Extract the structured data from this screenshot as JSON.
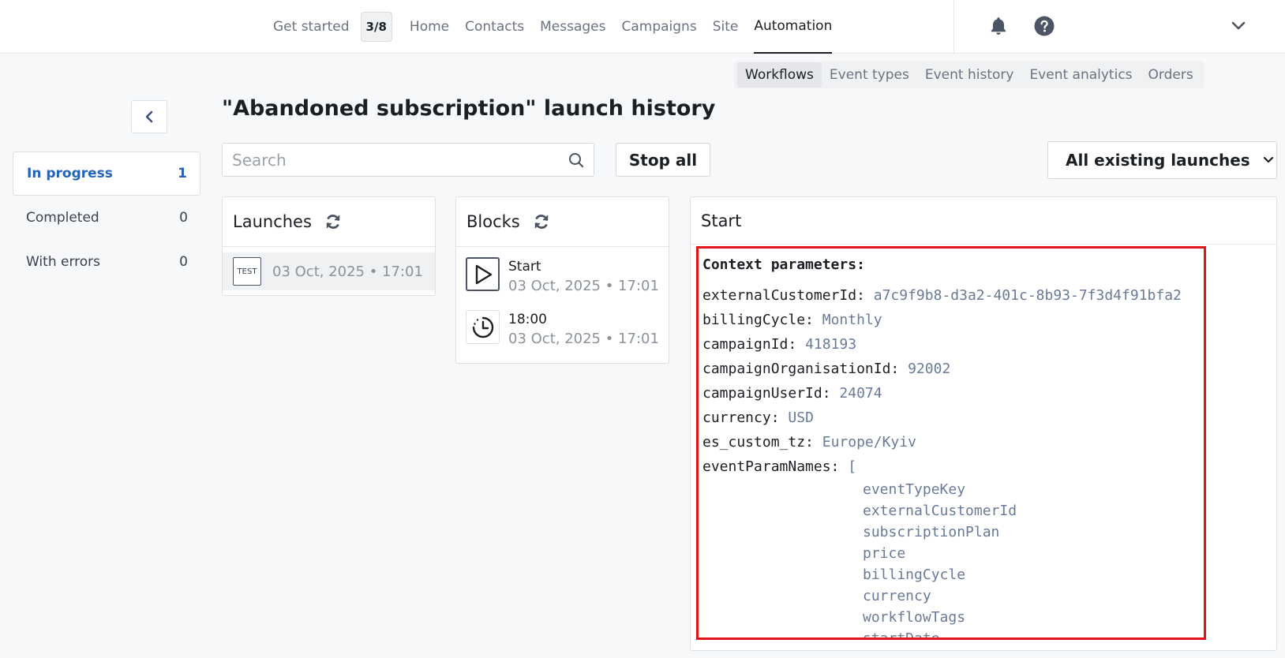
{
  "nav": {
    "get_started": "Get started",
    "progress": "3/8",
    "home": "Home",
    "contacts": "Contacts",
    "messages": "Messages",
    "campaigns": "Campaigns",
    "site": "Site",
    "automation": "Automation"
  },
  "subtabs": {
    "workflows": "Workflows",
    "event_types": "Event types",
    "event_history": "Event history",
    "event_analytics": "Event analytics",
    "orders": "Orders"
  },
  "page_title": "\"Abandoned subscription\" launch history",
  "search": {
    "placeholder": "Search"
  },
  "stop_all": "Stop all",
  "filter": {
    "selected": "All existing launches"
  },
  "statuses": [
    {
      "label": "In progress",
      "count": "1"
    },
    {
      "label": "Completed",
      "count": "0"
    },
    {
      "label": "With errors",
      "count": "0"
    }
  ],
  "launches_panel": {
    "title": "Launches",
    "items": [
      {
        "badge": "TEST",
        "time": "03 Oct, 2025 • 17:01"
      }
    ]
  },
  "blocks_panel": {
    "title": "Blocks",
    "items": [
      {
        "name": "Start",
        "time": "03 Oct, 2025 • 17:01",
        "icon": "play-icon"
      },
      {
        "name": "18:00",
        "time": "03 Oct, 2025 • 17:01",
        "icon": "clock-icon"
      }
    ]
  },
  "detail": {
    "title": "Start",
    "context_title": "Context parameters:",
    "params": [
      {
        "key": "externalCustomerId:",
        "value": "a7c9f9b8-d3a2-401c-8b93-7f3d4f91bfa2"
      },
      {
        "key": "billingCycle:",
        "value": "Monthly"
      },
      {
        "key": "campaignId:",
        "value": "418193"
      },
      {
        "key": "campaignOrganisationId:",
        "value": "92002"
      },
      {
        "key": "campaignUserId:",
        "value": "24074"
      },
      {
        "key": "currency:",
        "value": "USD"
      },
      {
        "key": "es_custom_tz:",
        "value": "Europe/Kyiv"
      },
      {
        "key": "eventParamNames:",
        "value": "["
      }
    ],
    "event_param_names": [
      "eventTypeKey",
      "externalCustomerId",
      "subscriptionPlan",
      "price",
      "billingCycle",
      "currency",
      "workflowTags",
      "startDate"
    ]
  },
  "colors": {
    "accent": "#2563b8",
    "highlight_border": "#e3121b",
    "value_text": "#6a7a99"
  }
}
